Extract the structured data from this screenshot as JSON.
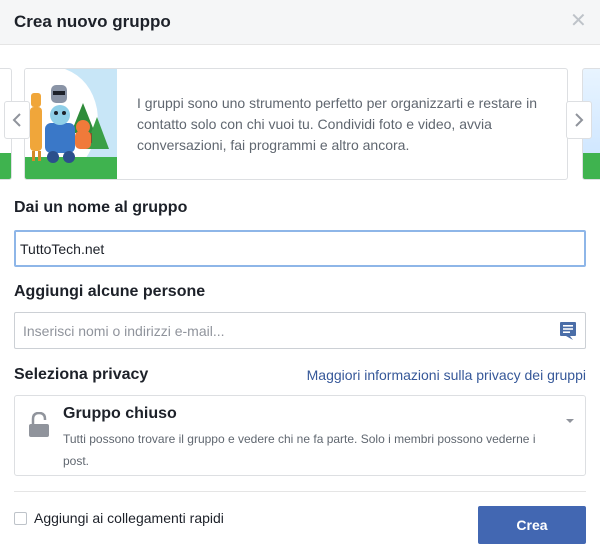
{
  "dialog": {
    "title": "Crea nuovo gruppo",
    "close_icon": "close-icon"
  },
  "carousel": {
    "description": "I gruppi sono uno strumento perfetto per organizzarti e restare in contatto solo con chi vuoi tu. Condividi foto e video, avvia conversazioni, fai programmi e altro ancora.",
    "prev_icon": "chevron-left-icon",
    "next_icon": "chevron-right-icon"
  },
  "name_section": {
    "label": "Dai un nome al gruppo",
    "value": "TuttoTech.net"
  },
  "people_section": {
    "label": "Aggiungi alcune persone",
    "placeholder": "Inserisci nomi o indirizzi e-mail...",
    "icon": "contact-list-icon"
  },
  "privacy_section": {
    "label": "Seleziona privacy",
    "link": "Maggiori informazioni sulla privacy dei gruppi",
    "selected_title": "Gruppo chiuso",
    "selected_desc": "Tutti possono trovare il gruppo e vedere chi ne fa parte. Solo i membri possono vederne i post.",
    "icon": "lock-icon"
  },
  "footer": {
    "shortcut_label": "Aggiungi ai collegamenti rapidi",
    "create_label": "Crea"
  },
  "colors": {
    "accent": "#4267b2",
    "link": "#365899",
    "header_bg": "#f5f6f7"
  }
}
